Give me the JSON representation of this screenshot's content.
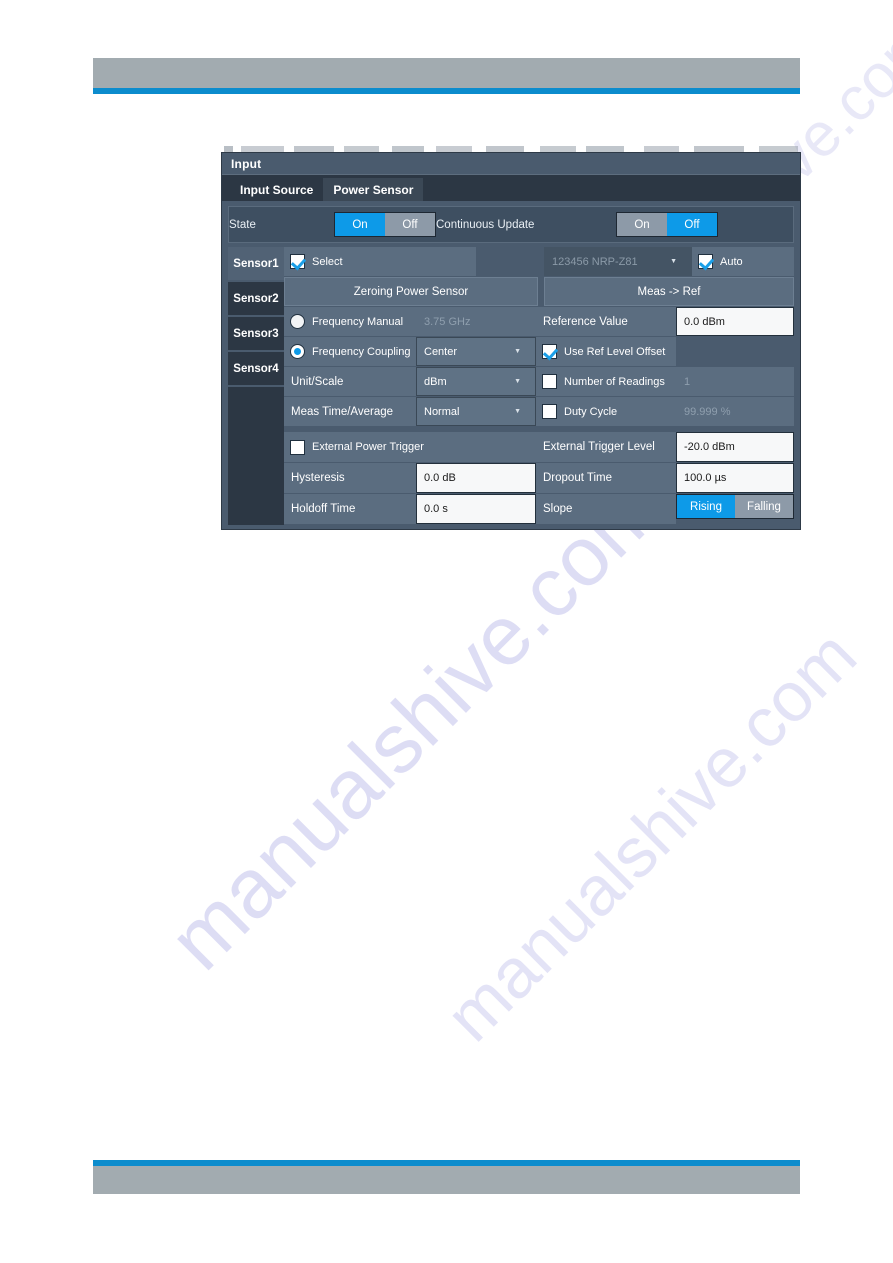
{
  "watermark": {
    "text": "manualshive.com"
  },
  "dialog": {
    "title": "Input",
    "tabs": [
      {
        "id": "input-source",
        "label": "Input Source",
        "active": false
      },
      {
        "id": "power-sensor",
        "label": "Power Sensor",
        "active": true
      }
    ],
    "state": {
      "label": "State",
      "options": [
        "On",
        "Off"
      ],
      "selected": "On"
    },
    "continuous_update": {
      "label": "Continuous Update",
      "options": [
        "On",
        "Off"
      ],
      "selected": "Off"
    },
    "sensor_tabs": [
      {
        "label": "Sensor1",
        "active": true
      },
      {
        "label": "Sensor2",
        "active": false
      },
      {
        "label": "Sensor3",
        "active": false
      },
      {
        "label": "Sensor4",
        "active": false
      }
    ],
    "select_checkbox": {
      "label": "Select",
      "checked": true
    },
    "device_dropdown": {
      "value": "123456 NRP-Z81",
      "disabled": true
    },
    "auto_checkbox": {
      "label": "Auto",
      "checked": true
    },
    "zeroing_button": {
      "label": "Zeroing Power Sensor"
    },
    "meas_ref_button": {
      "label": "Meas -> Ref"
    },
    "frequency_manual": {
      "label": "Frequency Manual",
      "selected": false,
      "value": "3.75 GHz",
      "disabled": true
    },
    "frequency_coupling": {
      "label": "Frequency Coupling",
      "selected": true,
      "value": "Center"
    },
    "reference_value": {
      "label": "Reference Value",
      "value": "0.0 dBm"
    },
    "use_ref_level_offset": {
      "label": "Use Ref Level Offset",
      "checked": true
    },
    "unit_scale": {
      "label": "Unit/Scale",
      "value": "dBm"
    },
    "number_of_readings": {
      "label": "Number of Readings",
      "checked": false,
      "value": "1",
      "disabled": true
    },
    "meas_time_average": {
      "label": "Meas Time/Average",
      "value": "Normal"
    },
    "duty_cycle": {
      "label": "Duty Cycle",
      "checked": false,
      "value": "99.999 %",
      "disabled": true
    },
    "external_power_trigger": {
      "label": "External Power Trigger",
      "checked": false
    },
    "external_trigger_level": {
      "label": "External Trigger Level",
      "value": "-20.0 dBm"
    },
    "hysteresis": {
      "label": "Hysteresis",
      "value": "0.0 dB"
    },
    "dropout_time": {
      "label": "Dropout Time",
      "value": "100.0 µs"
    },
    "holdoff_time": {
      "label": "Holdoff Time",
      "value": "0.0 s"
    },
    "slope": {
      "label": "Slope",
      "options": [
        "Rising",
        "Falling"
      ],
      "selected": "Rising"
    }
  },
  "colors": {
    "accent_blue": "#0d9ae8",
    "rule_blue": "#0c8ccd",
    "header_grey": "#a2abb0",
    "dialog_bg": "#4a5b6e",
    "dark_panel": "#2c3744"
  }
}
